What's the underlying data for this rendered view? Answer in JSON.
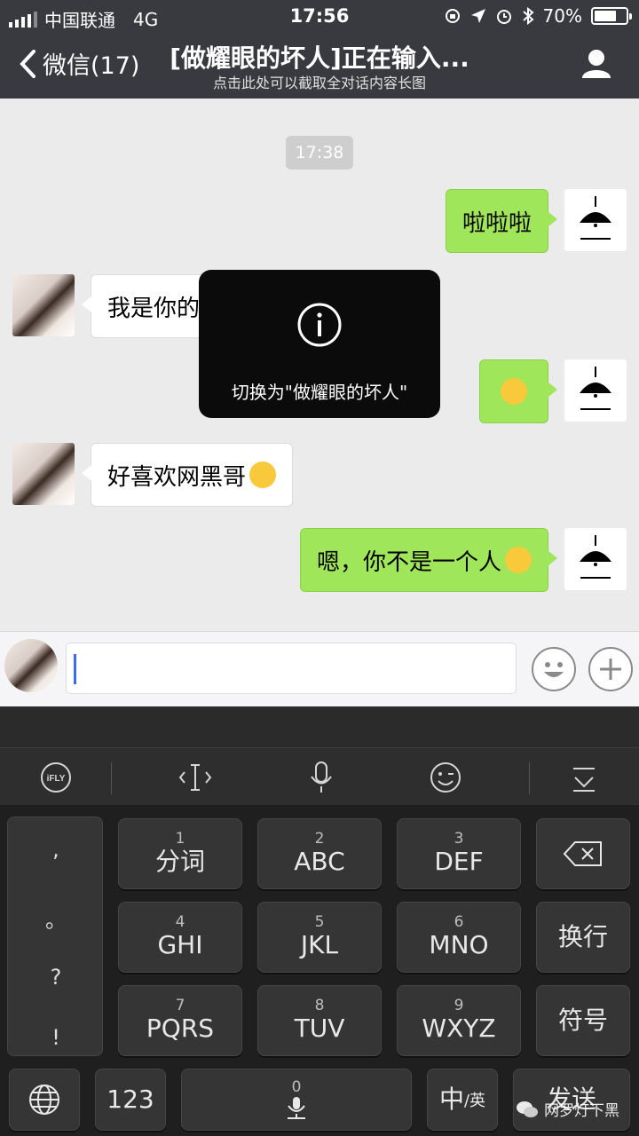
{
  "status": {
    "carrier": "中国联通",
    "network": "4G",
    "time": "17:56",
    "battery": "70%",
    "battery_level": 0.7
  },
  "nav": {
    "back_label": "微信(17)",
    "title": "[做耀眼的坏人]正在输入...",
    "subtitle": "点击此处可以截取全对话内容长图"
  },
  "chat": {
    "timestamp": "17:38",
    "messages": [
      {
        "side": "me",
        "text": "啦啦啦"
      },
      {
        "side": "them",
        "text": "我是你的"
      },
      {
        "side": "me",
        "text": "",
        "emoji": "thinking-emoji"
      },
      {
        "side": "them",
        "text": "好喜欢网黑哥",
        "emoji": "heart-eyes-emoji"
      },
      {
        "side": "me",
        "text": "嗯，你不是一个人",
        "emoji": "sunglasses-emoji"
      }
    ]
  },
  "toast": {
    "icon": "info-icon",
    "message": "切换为\"做耀眼的坏人\""
  },
  "input": {
    "value": ""
  },
  "keyboard": {
    "toolbar": [
      "iFLY",
      "cursor",
      "mic",
      "emoji",
      "collapse"
    ],
    "punct": [
      ",",
      "。",
      "?",
      "!"
    ],
    "keys": [
      {
        "num": "1",
        "label": "分词"
      },
      {
        "num": "2",
        "label": "ABC"
      },
      {
        "num": "3",
        "label": "DEF"
      },
      {
        "num": "4",
        "label": "GHI"
      },
      {
        "num": "5",
        "label": "JKL"
      },
      {
        "num": "6",
        "label": "MNO"
      },
      {
        "num": "7",
        "label": "PQRS"
      },
      {
        "num": "8",
        "label": "TUV"
      },
      {
        "num": "9",
        "label": "WXYZ"
      }
    ],
    "newline": "换行",
    "symbols": "符号",
    "num_key": "123",
    "space_num": "0",
    "lang_main": "中",
    "lang_sub": "/英",
    "send": "发送"
  },
  "watermark": "网罗灯下黑"
}
